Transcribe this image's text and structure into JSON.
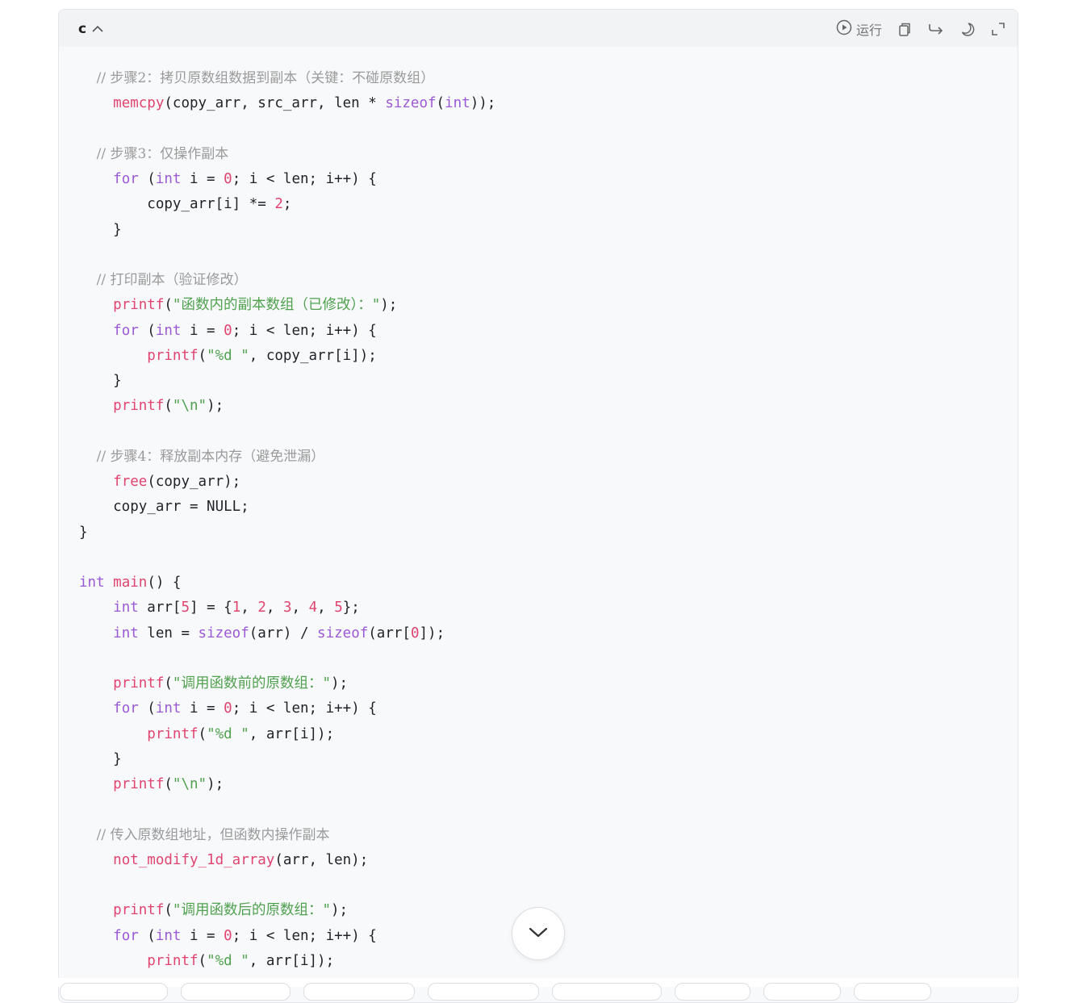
{
  "code_block": {
    "language": "c",
    "run_label": "运行",
    "icons": {
      "run": "play-circle-icon",
      "copy": "copy-icon",
      "wrap": "wrap-arrow-icon",
      "theme": "moon-icon",
      "expand": "expand-icon",
      "collapse": "chevron-up-icon",
      "scroll": "chevron-down-icon"
    },
    "lines": [
      [
        {
          "t": "c",
          "v": "    // 步骤2：拷贝原数组数据到副本（关键：不碰原数组）"
        }
      ],
      [
        {
          "t": "d",
          "v": "    "
        },
        {
          "t": "f",
          "v": "memcpy"
        },
        {
          "t": "d",
          "v": "(copy_arr, src_arr, len * "
        },
        {
          "t": "k",
          "v": "sizeof"
        },
        {
          "t": "d",
          "v": "("
        },
        {
          "t": "k",
          "v": "int"
        },
        {
          "t": "d",
          "v": "));"
        }
      ],
      [],
      [
        {
          "t": "c",
          "v": "    // 步骤3：仅操作副本"
        }
      ],
      [
        {
          "t": "d",
          "v": "    "
        },
        {
          "t": "k",
          "v": "for"
        },
        {
          "t": "d",
          "v": " ("
        },
        {
          "t": "k",
          "v": "int"
        },
        {
          "t": "d",
          "v": " i = "
        },
        {
          "t": "n",
          "v": "0"
        },
        {
          "t": "d",
          "v": "; i < len; i++) {"
        }
      ],
      [
        {
          "t": "d",
          "v": "        copy_arr[i] *= "
        },
        {
          "t": "n",
          "v": "2"
        },
        {
          "t": "d",
          "v": ";"
        }
      ],
      [
        {
          "t": "d",
          "v": "    }"
        }
      ],
      [],
      [
        {
          "t": "c",
          "v": "    // 打印副本（验证修改）"
        }
      ],
      [
        {
          "t": "d",
          "v": "    "
        },
        {
          "t": "f",
          "v": "printf"
        },
        {
          "t": "d",
          "v": "("
        },
        {
          "t": "s",
          "v": "\"函数内的副本数组（已修改）：\""
        },
        {
          "t": "d",
          "v": ");"
        }
      ],
      [
        {
          "t": "d",
          "v": "    "
        },
        {
          "t": "k",
          "v": "for"
        },
        {
          "t": "d",
          "v": " ("
        },
        {
          "t": "k",
          "v": "int"
        },
        {
          "t": "d",
          "v": " i = "
        },
        {
          "t": "n",
          "v": "0"
        },
        {
          "t": "d",
          "v": "; i < len; i++) {"
        }
      ],
      [
        {
          "t": "d",
          "v": "        "
        },
        {
          "t": "f",
          "v": "printf"
        },
        {
          "t": "d",
          "v": "("
        },
        {
          "t": "s",
          "v": "\"%d \""
        },
        {
          "t": "d",
          "v": ", copy_arr[i]);"
        }
      ],
      [
        {
          "t": "d",
          "v": "    }"
        }
      ],
      [
        {
          "t": "d",
          "v": "    "
        },
        {
          "t": "f",
          "v": "printf"
        },
        {
          "t": "d",
          "v": "("
        },
        {
          "t": "s",
          "v": "\"\\n\""
        },
        {
          "t": "d",
          "v": ");"
        }
      ],
      [],
      [
        {
          "t": "c",
          "v": "    // 步骤4：释放副本内存（避免泄漏）"
        }
      ],
      [
        {
          "t": "d",
          "v": "    "
        },
        {
          "t": "f",
          "v": "free"
        },
        {
          "t": "d",
          "v": "(copy_arr);"
        }
      ],
      [
        {
          "t": "d",
          "v": "    copy_arr = NULL;"
        }
      ],
      [
        {
          "t": "d",
          "v": "}"
        }
      ],
      [],
      [
        {
          "t": "k",
          "v": "int"
        },
        {
          "t": "d",
          "v": " "
        },
        {
          "t": "f",
          "v": "main"
        },
        {
          "t": "d",
          "v": "() {"
        }
      ],
      [
        {
          "t": "d",
          "v": "    "
        },
        {
          "t": "k",
          "v": "int"
        },
        {
          "t": "d",
          "v": " arr["
        },
        {
          "t": "n",
          "v": "5"
        },
        {
          "t": "d",
          "v": "] = {"
        },
        {
          "t": "n",
          "v": "1"
        },
        {
          "t": "d",
          "v": ", "
        },
        {
          "t": "n",
          "v": "2"
        },
        {
          "t": "d",
          "v": ", "
        },
        {
          "t": "n",
          "v": "3"
        },
        {
          "t": "d",
          "v": ", "
        },
        {
          "t": "n",
          "v": "4"
        },
        {
          "t": "d",
          "v": ", "
        },
        {
          "t": "n",
          "v": "5"
        },
        {
          "t": "d",
          "v": "};"
        }
      ],
      [
        {
          "t": "d",
          "v": "    "
        },
        {
          "t": "k",
          "v": "int"
        },
        {
          "t": "d",
          "v": " len = "
        },
        {
          "t": "k",
          "v": "sizeof"
        },
        {
          "t": "d",
          "v": "(arr) / "
        },
        {
          "t": "k",
          "v": "sizeof"
        },
        {
          "t": "d",
          "v": "(arr["
        },
        {
          "t": "n",
          "v": "0"
        },
        {
          "t": "d",
          "v": "]);"
        }
      ],
      [],
      [
        {
          "t": "d",
          "v": "    "
        },
        {
          "t": "f",
          "v": "printf"
        },
        {
          "t": "d",
          "v": "("
        },
        {
          "t": "s",
          "v": "\"调用函数前的原数组：\""
        },
        {
          "t": "d",
          "v": ");"
        }
      ],
      [
        {
          "t": "d",
          "v": "    "
        },
        {
          "t": "k",
          "v": "for"
        },
        {
          "t": "d",
          "v": " ("
        },
        {
          "t": "k",
          "v": "int"
        },
        {
          "t": "d",
          "v": " i = "
        },
        {
          "t": "n",
          "v": "0"
        },
        {
          "t": "d",
          "v": "; i < len; i++) {"
        }
      ],
      [
        {
          "t": "d",
          "v": "        "
        },
        {
          "t": "f",
          "v": "printf"
        },
        {
          "t": "d",
          "v": "("
        },
        {
          "t": "s",
          "v": "\"%d \""
        },
        {
          "t": "d",
          "v": ", arr[i]);"
        }
      ],
      [
        {
          "t": "d",
          "v": "    }"
        }
      ],
      [
        {
          "t": "d",
          "v": "    "
        },
        {
          "t": "f",
          "v": "printf"
        },
        {
          "t": "d",
          "v": "("
        },
        {
          "t": "s",
          "v": "\"\\n\""
        },
        {
          "t": "d",
          "v": ");"
        }
      ],
      [],
      [
        {
          "t": "c",
          "v": "    // 传入原数组地址，但函数内操作副本"
        }
      ],
      [
        {
          "t": "d",
          "v": "    "
        },
        {
          "t": "f",
          "v": "not_modify_1d_array"
        },
        {
          "t": "d",
          "v": "(arr, len);"
        }
      ],
      [],
      [
        {
          "t": "d",
          "v": "    "
        },
        {
          "t": "f",
          "v": "printf"
        },
        {
          "t": "d",
          "v": "("
        },
        {
          "t": "s",
          "v": "\"调用函数后的原数组：\""
        },
        {
          "t": "d",
          "v": ");"
        }
      ],
      [
        {
          "t": "d",
          "v": "    "
        },
        {
          "t": "k",
          "v": "for"
        },
        {
          "t": "d",
          "v": " ("
        },
        {
          "t": "k",
          "v": "int"
        },
        {
          "t": "d",
          "v": " i = "
        },
        {
          "t": "n",
          "v": "0"
        },
        {
          "t": "d",
          "v": "; i < len; i++) {"
        }
      ],
      [
        {
          "t": "d",
          "v": "        "
        },
        {
          "t": "f",
          "v": "printf"
        },
        {
          "t": "d",
          "v": "("
        },
        {
          "t": "s",
          "v": "\"%d \""
        },
        {
          "t": "d",
          "v": ", arr[i]);"
        }
      ]
    ]
  },
  "colors": {
    "keyword": "#9b59d6",
    "function": "#e0446f",
    "number": "#e0446f",
    "string": "#50a14f",
    "comment": "#9a9a9a",
    "default": "#1f2328",
    "code_background": "#f8f9fb"
  }
}
